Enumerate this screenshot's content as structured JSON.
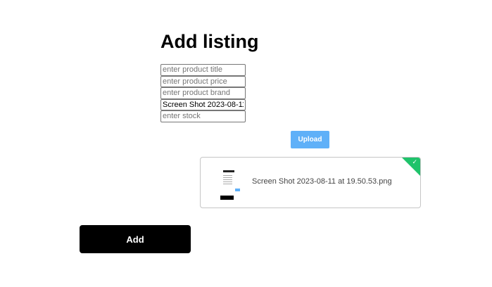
{
  "page": {
    "title": "Add listing"
  },
  "form": {
    "fields": [
      {
        "name": "title",
        "placeholder": "enter product title",
        "value": ""
      },
      {
        "name": "price",
        "placeholder": "enter product price",
        "value": ""
      },
      {
        "name": "brand",
        "placeholder": "enter product brand",
        "value": ""
      },
      {
        "name": "image",
        "placeholder": "",
        "value": "Screen Shot 2023-08-11"
      },
      {
        "name": "stock",
        "placeholder": "enter stock",
        "value": ""
      }
    ]
  },
  "upload": {
    "button_label": "Upload",
    "file": {
      "name": "Screen Shot 2023-08-11 at 19.50.53.png",
      "status": "success",
      "status_icon": "check-icon",
      "status_color": "#1fc36b"
    }
  },
  "actions": {
    "add_label": "Add"
  },
  "colors": {
    "upload_button": "#5fb0f8",
    "add_button": "#000000"
  }
}
